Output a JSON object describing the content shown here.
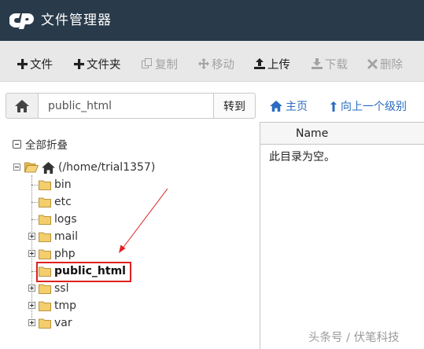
{
  "header": {
    "app_title": "文件管理器",
    "logo_icon": "cpanel-logo",
    "background": "#293a4a"
  },
  "toolbar": {
    "items": [
      {
        "label": "文件",
        "icon": "plus-icon",
        "enabled": true
      },
      {
        "label": "文件夹",
        "icon": "plus-icon",
        "enabled": true
      },
      {
        "label": "复制",
        "icon": "copy-icon",
        "enabled": false
      },
      {
        "label": "移动",
        "icon": "move-icon",
        "enabled": false
      },
      {
        "label": "上传",
        "icon": "upload-icon",
        "enabled": true
      },
      {
        "label": "下载",
        "icon": "download-icon",
        "enabled": false
      },
      {
        "label": "删除",
        "icon": "delete-icon",
        "enabled": false
      }
    ]
  },
  "pathbar": {
    "path_value": "public_html",
    "go_label": "转到",
    "home_link": "主页",
    "up_link": "向上一个级别",
    "link_color": "#2a6cc1"
  },
  "tree": {
    "collapse_all": "全部折叠",
    "root_label": "(/home/trial1357)",
    "children": [
      {
        "label": "bin",
        "expandable": false
      },
      {
        "label": "etc",
        "expandable": false
      },
      {
        "label": "logs",
        "expandable": false
      },
      {
        "label": "mail",
        "expandable": true
      },
      {
        "label": "php",
        "expandable": true
      },
      {
        "label": "public_html",
        "expandable": false,
        "selected": true
      },
      {
        "label": "ssl",
        "expandable": true
      },
      {
        "label": "tmp",
        "expandable": true
      },
      {
        "label": "var",
        "expandable": true
      }
    ]
  },
  "file_list": {
    "column_name": "Name",
    "empty_message": "此目录为空。"
  },
  "annotation": {
    "highlight_color": "#e02020"
  },
  "watermark": "头条号 / 伏笔科技"
}
